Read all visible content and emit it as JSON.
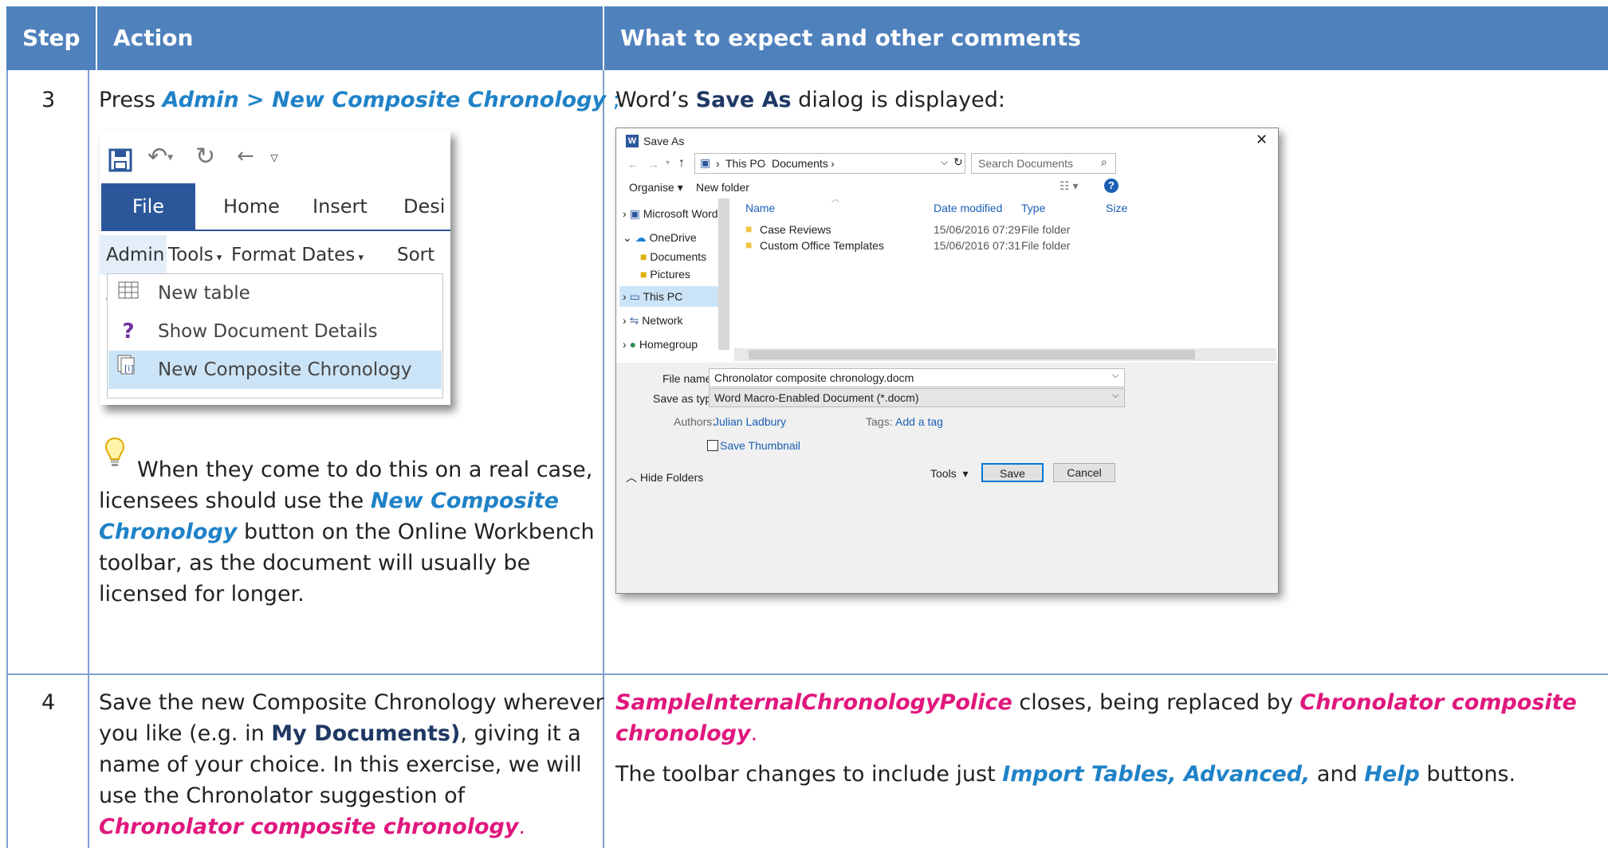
{
  "table": {
    "headers": [
      "Step",
      "Action",
      "What to expect and other comments"
    ],
    "row3": {
      "step": "3",
      "action": {
        "press": "Press ",
        "link": "Admin > New Composite Chronology",
        "semicolon": " ;",
        "tip_part1": "When they come to do this on a real case,",
        "tip_part2": "licensees should use the ",
        "tip_link1": "New Composite",
        "tip_link2": "Chronology",
        "tip_part3": "  button on the Online Workbench",
        "tip_part4": "toolbar, as the document will usually be",
        "tip_part5": "licensed for longer."
      },
      "comment": {
        "prefix": "Word’s ",
        "bold": "Save As",
        "suffix": " dialog is displayed:"
      }
    },
    "row4": {
      "step": "4",
      "action": {
        "line1": "Save the new Composite Chronology wherever",
        "line2a": "you like (e.g. in ",
        "line2b": "My Documents)",
        "line2c": ", giving it a",
        "line3": "name of your choice. In this exercise, we will",
        "line4": "use the Chronolator suggestion of",
        "line5": "Chronolator composite chronology",
        "line5end": "."
      },
      "comment": {
        "l1a": "SampleInternalChronologyPolice",
        "l1b": " closes, being replaced by ",
        "l1c": "Chronolator composite",
        "l2a": "chronology",
        "l2b": ".",
        "l3a": "The toolbar changes to include just ",
        "l3b": "Import Tables, Advanced,",
        "l3c": "  and ",
        "l3d": "Help",
        "l3e": " buttons."
      }
    }
  },
  "ribbon": {
    "tabs": [
      "File",
      "Home",
      "Insert",
      "Desi"
    ],
    "menus": [
      "Admin",
      "Tools",
      "Format Dates",
      "Sort T"
    ],
    "dropdown": [
      "New table",
      "Show Document Details",
      "New Composite Chronology"
    ]
  },
  "save_dialog": {
    "title": "Save As",
    "breadcrumb": [
      "This PC",
      "Documents"
    ],
    "search_placeholder": "Search Documents",
    "organise": "Organise",
    "new_folder": "New folder",
    "nav_items": [
      "Microsoft Word",
      "OneDrive",
      "Documents",
      "Pictures",
      "This PC",
      "Network",
      "Homegroup"
    ],
    "columns": [
      "Name",
      "Date modified",
      "Type",
      "Size"
    ],
    "files": [
      {
        "name": "Case Reviews",
        "date": "15/06/2016 07:29",
        "type": "File folder"
      },
      {
        "name": "Custom Office Templates",
        "date": "15/06/2016 07:31",
        "type": "File folder"
      }
    ],
    "file_name_label": "File name:",
    "file_name": "Chronolator composite chronology.docm",
    "save_type_label": "Save as type:",
    "save_type": "Word Macro-Enabled Document (*.docm)",
    "authors_label": "Authors:",
    "authors": "Julian Ladbury",
    "tags_label": "Tags:",
    "tags": "Add a tag",
    "thumbnail": "Save Thumbnail",
    "hide_folders": "Hide Folders",
    "tools": "Tools",
    "save": "Save",
    "cancel": "Cancel"
  },
  "colors": {
    "header": "#4f81bd",
    "link_blue": "#1f82c7",
    "link_pink": "#e0177d"
  }
}
